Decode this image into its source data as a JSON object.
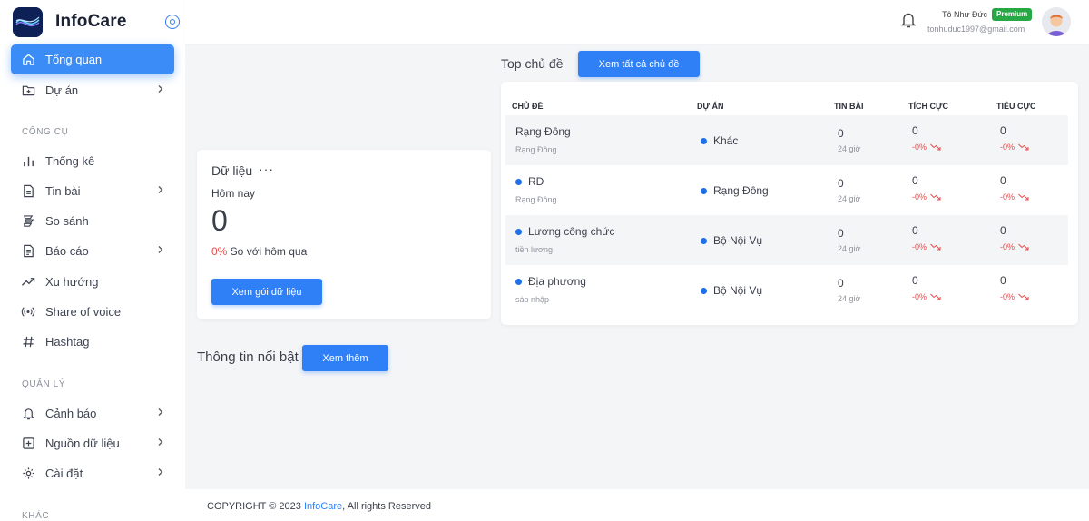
{
  "app": {
    "name": "InfoCare"
  },
  "sidebar": {
    "items": [
      {
        "label": "Tổng quan"
      },
      {
        "label": "Dự án"
      },
      {
        "label": "Thống kê"
      },
      {
        "label": "Tin bài"
      },
      {
        "label": "So sánh"
      },
      {
        "label": "Báo cáo"
      },
      {
        "label": "Xu hướng"
      },
      {
        "label": "Share of voice"
      },
      {
        "label": "Hashtag"
      },
      {
        "label": "Cảnh báo"
      },
      {
        "label": "Nguồn dữ liệu"
      },
      {
        "label": "Cài đặt"
      }
    ],
    "sections": {
      "tools": "CÔNG CỤ",
      "manage": "QUẢN LÝ",
      "other": "KHÁC"
    }
  },
  "header": {
    "user_name": "Tô Như Đức",
    "badge": "Premium",
    "email": "tonhuduc1997@gmail.com"
  },
  "data_card": {
    "title": "Dữ liệu",
    "more": "···",
    "period": "Hôm nay",
    "value": "0",
    "change_pct": "0%",
    "change_text": " So với hôm qua",
    "button": "Xem gói dữ liệu"
  },
  "topics": {
    "title": "Top chủ đề",
    "button": "Xem tất cả chủ đề",
    "columns": [
      "CHỦ ĐỀ",
      "DỰ ÁN",
      "TIN BÀI",
      "TÍCH CỰC",
      "TIÊU CỰC"
    ],
    "rows": [
      {
        "name": "Rạng Đông",
        "sub": "Rạng Đông",
        "project": "Khác",
        "count": "0",
        "time": "24 giờ",
        "positive": "0",
        "positive_pct": "-0%",
        "negative": "0",
        "negative_pct": "-0%"
      },
      {
        "name": "RD",
        "sub": "Rạng Đông",
        "project": "Rạng Đông",
        "count": "0",
        "time": "24 giờ",
        "positive": "0",
        "positive_pct": "-0%",
        "negative": "0",
        "negative_pct": "-0%"
      },
      {
        "name": "Lương công chức",
        "sub": "tiền lương",
        "project": "Bộ Nội Vụ",
        "count": "0",
        "time": "24 giờ",
        "positive": "0",
        "positive_pct": "-0%",
        "negative": "0",
        "negative_pct": "-0%"
      },
      {
        "name": "Địa phương",
        "sub": "sáp nhập",
        "project": "Bộ Nội Vụ",
        "count": "0",
        "time": "24 giờ",
        "positive": "0",
        "positive_pct": "-0%",
        "negative": "0",
        "negative_pct": "-0%"
      }
    ]
  },
  "highlights": {
    "title": "Thông tin nổi bật",
    "button": "Xem thêm"
  },
  "footer": {
    "prefix": "COPYRIGHT © 2023 ",
    "brand": "InfoCare",
    "suffix": ", All rights Reserved"
  },
  "colors": {
    "primary": "#2f80f7",
    "active_nav": "#3b8cf7",
    "premium": "#28a745",
    "negative": "#e84a4a"
  }
}
